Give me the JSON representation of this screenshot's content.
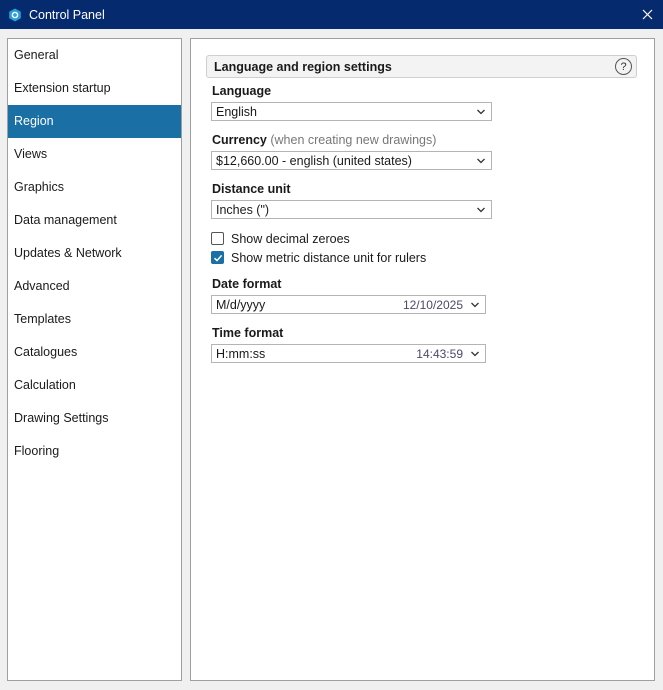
{
  "window": {
    "title": "Control Panel",
    "colors": {
      "titlebar": "#062a6e",
      "accent": "#1a6fa5"
    }
  },
  "nav": {
    "items": [
      {
        "label": "General"
      },
      {
        "label": "Extension startup"
      },
      {
        "label": "Region",
        "selected": true
      },
      {
        "label": "Views"
      },
      {
        "label": "Graphics"
      },
      {
        "label": "Data management"
      },
      {
        "label": "Updates & Network"
      },
      {
        "label": "Advanced"
      },
      {
        "label": "Templates"
      },
      {
        "label": "Catalogues"
      },
      {
        "label": "Calculation"
      },
      {
        "label": "Drawing Settings"
      },
      {
        "label": "Flooring"
      }
    ]
  },
  "region": {
    "section_title": "Language and region settings",
    "help_label": "?",
    "language": {
      "label": "Language",
      "value": "English"
    },
    "currency": {
      "label": "Currency",
      "note": " (when creating new drawings)",
      "value": "$12,660.00 - english (united states)"
    },
    "distance": {
      "label": "Distance unit",
      "value": "Inches (\")"
    },
    "show_decimal_zeroes": {
      "label": "Show decimal zeroes",
      "checked": false
    },
    "show_metric_rulers": {
      "label": "Show metric distance unit for rulers",
      "checked": true
    },
    "date_format": {
      "label": "Date format",
      "value": "M/d/yyyy",
      "preview": "12/10/2025"
    },
    "time_format": {
      "label": "Time format",
      "value": "H:mm:ss",
      "preview": "14:43:59"
    }
  }
}
